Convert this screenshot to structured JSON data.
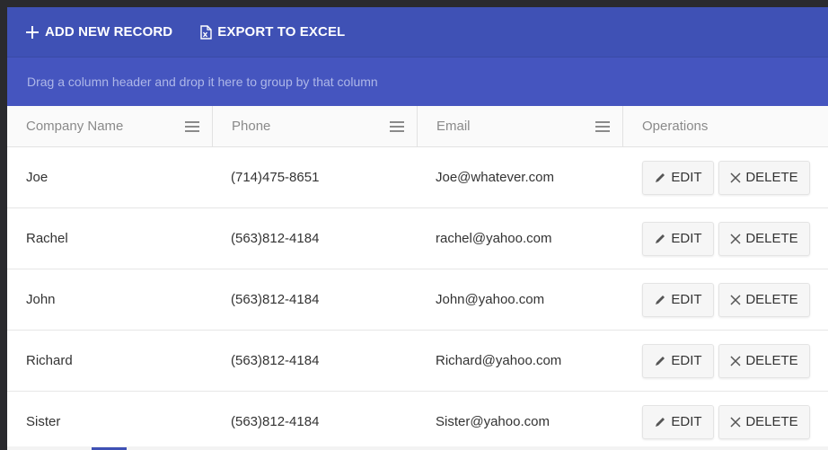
{
  "toolbar": {
    "add_label": "ADD NEW RECORD",
    "export_label": "EXPORT TO EXCEL",
    "bg_color": "#3f51b5"
  },
  "group_panel": {
    "hint": "Drag a column header and drop it here to group by that column"
  },
  "columns": [
    "Company Name",
    "Phone",
    "Email",
    "Operations"
  ],
  "rows": [
    {
      "company": "Joe",
      "phone": "(714)475-8651",
      "email": "Joe@whatever.com"
    },
    {
      "company": "Rachel",
      "phone": "(563)812-4184",
      "email": "rachel@yahoo.com"
    },
    {
      "company": "John",
      "phone": "(563)812-4184",
      "email": "John@yahoo.com"
    },
    {
      "company": "Richard",
      "phone": "(563)812-4184",
      "email": "Richard@yahoo.com"
    },
    {
      "company": "Sister",
      "phone": "(563)812-4184",
      "email": "Sister@yahoo.com"
    }
  ],
  "actions": {
    "edit_label": "EDIT",
    "delete_label": "DELETE"
  },
  "icons": {
    "add": "plus-icon",
    "export": "excel-file-icon",
    "column_menu": "hamburger-menu-icon",
    "edit": "pencil-icon",
    "delete": "close-icon"
  }
}
